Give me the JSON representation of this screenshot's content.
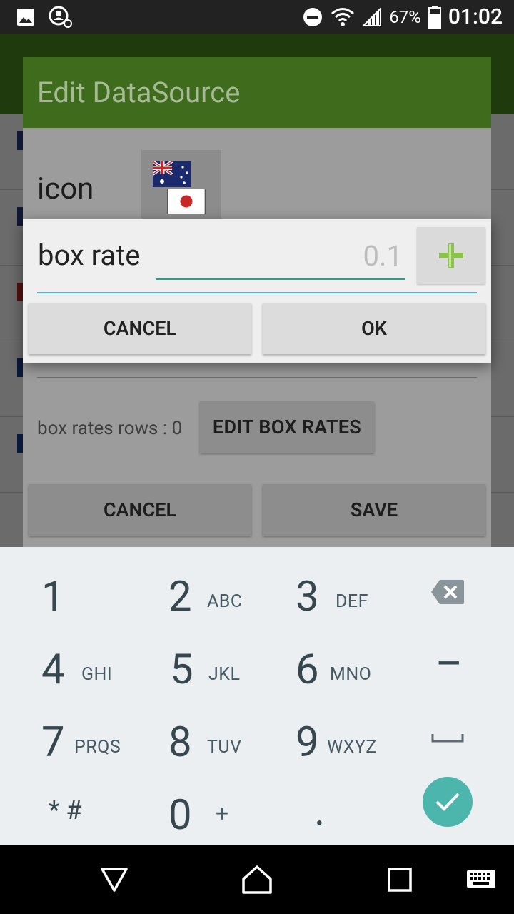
{
  "status_bar": {
    "battery": "67%",
    "time": "01:02",
    "icons": [
      "image-icon",
      "account-icon",
      "do-not-disturb-icon",
      "wifi-icon",
      "cell-signal-icon",
      "battery-icon"
    ]
  },
  "edit_dialog": {
    "title": "Edit DataSource",
    "icon_label": "icon",
    "box_rates_rows": "box rates rows : 0",
    "edit_box_rates": "EDIT BOX RATES",
    "cancel": "CANCEL",
    "save": "SAVE"
  },
  "box_rate_dialog": {
    "label": "box rate",
    "input_placeholder": "0.1",
    "plus_icon": "plus-icon",
    "cancel": "CANCEL",
    "ok": "OK"
  },
  "keyboard": {
    "keys": [
      {
        "digit": "1",
        "sub": ""
      },
      {
        "digit": "2",
        "sub": "ABC"
      },
      {
        "digit": "3",
        "sub": "DEF"
      },
      {
        "digit": "4",
        "sub": "GHI"
      },
      {
        "digit": "5",
        "sub": "JKL"
      },
      {
        "digit": "6",
        "sub": "MNO"
      },
      {
        "digit": "7",
        "sub": "PRQS"
      },
      {
        "digit": "8",
        "sub": "TUV"
      },
      {
        "digit": "9",
        "sub": "WXYZ"
      },
      {
        "digit": "* #",
        "sub": ""
      },
      {
        "digit": "0",
        "sub": "+"
      },
      {
        "digit": ".",
        "sub": ""
      }
    ],
    "minus": "–",
    "accent": "#4db6ac"
  },
  "colors": {
    "toolbar": "#4b8e1f",
    "input_underline": "#2a9d8f",
    "plus_green": "#8bc34a"
  }
}
